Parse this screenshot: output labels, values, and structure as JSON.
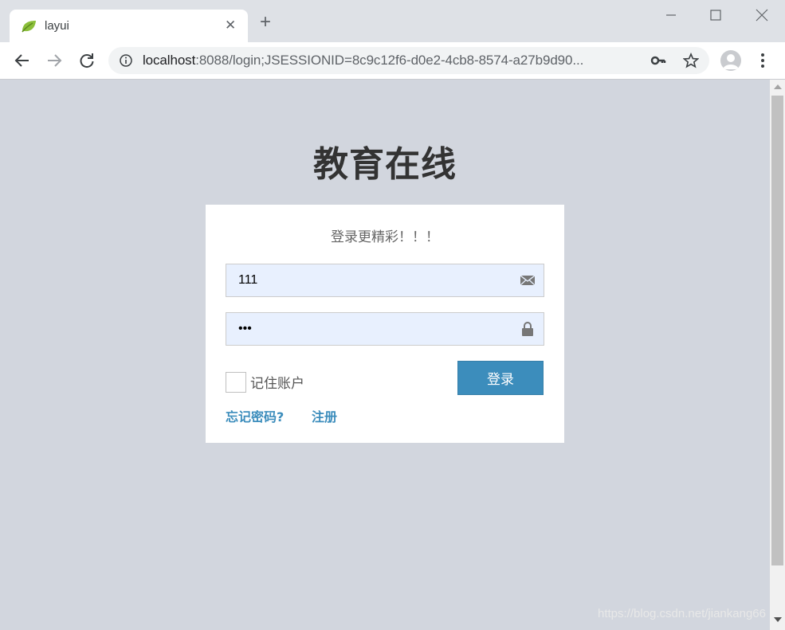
{
  "browser": {
    "tab_title": "layui",
    "url_host": "localhost",
    "url_rest": ":8088/login;JSESSIONID=8c9c12f6-d0e2-4cb8-8574-a27b9d90..."
  },
  "page": {
    "title": "教育在线",
    "login_message": "登录更精彩！！！",
    "username_value": "111",
    "password_value": "•••",
    "remember_label": "记住账户",
    "login_button": "登录",
    "forgot_link": "忘记密码?",
    "register_link": "注册",
    "watermark": "https://blog.csdn.net/jiankang66"
  },
  "colors": {
    "background": "#d2d6de",
    "primary": "#3c8dbc",
    "input_bg": "#e8f0fe"
  },
  "icons": {
    "username": "envelope-icon",
    "password": "lock-icon"
  }
}
